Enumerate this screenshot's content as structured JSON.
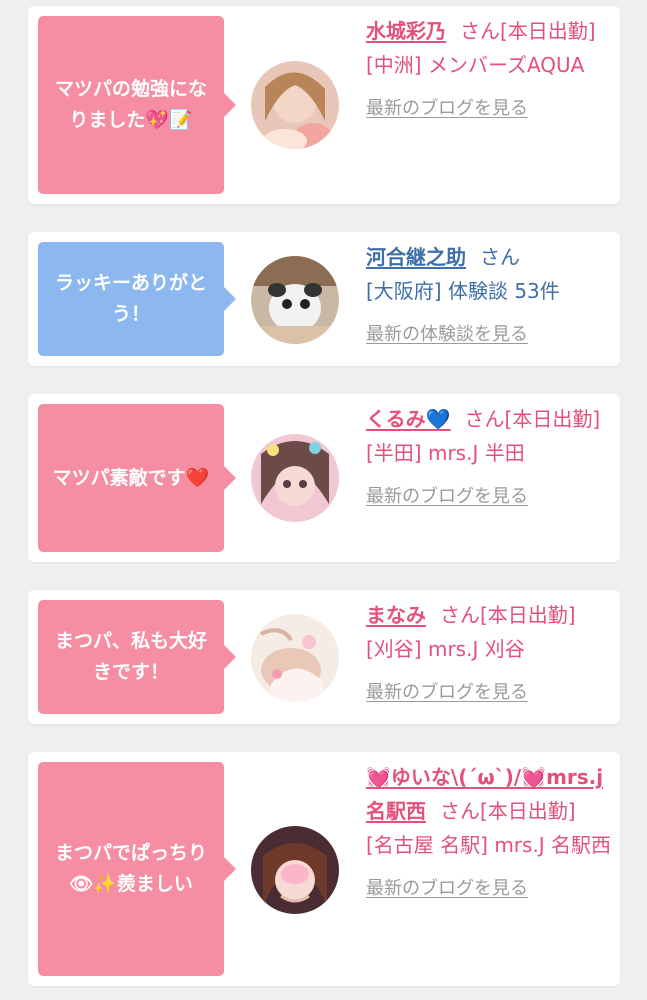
{
  "cards": [
    {
      "bubble": "マツパの勉強になりました💖📝",
      "name": "水城彩乃",
      "suffix": "さん[本日出勤]",
      "shop": "[中洲] メンバーズAQUA",
      "link": "最新のブログを見る",
      "bubble_color": "#f68ea3"
    },
    {
      "bubble": "ラッキーありがとう！",
      "name": "河合継之助",
      "suffix": "さん",
      "shop": "[大阪府] 体験談 53件",
      "link": "最新の体験談を見る",
      "bubble_color": "#8db7ef"
    },
    {
      "bubble": "マツパ素敵です❤️",
      "name": "くるみ💙",
      "suffix": "さん[本日出勤]",
      "shop": "[半田] mrs.J 半田",
      "link": "最新のブログを見る",
      "bubble_color": "#f68ea3"
    },
    {
      "bubble": "まつパ、私も大好きです！",
      "name": "まなみ",
      "suffix": "さん[本日出勤]",
      "shop": "[刈谷] mrs.J 刈谷",
      "link": "最新のブログを見る",
      "bubble_color": "#f68ea3"
    },
    {
      "bubble": "まつパでぱっちり👁✨羨ましい",
      "name": "💓ゆいな\\(ˊωˋ)/💓mrs.j名駅西",
      "suffix": "さん[本日出勤]",
      "shop": "[名古屋 名駅] mrs.J 名駅西",
      "link": "最新のブログを見る",
      "bubble_color": "#f68ea3"
    }
  ]
}
